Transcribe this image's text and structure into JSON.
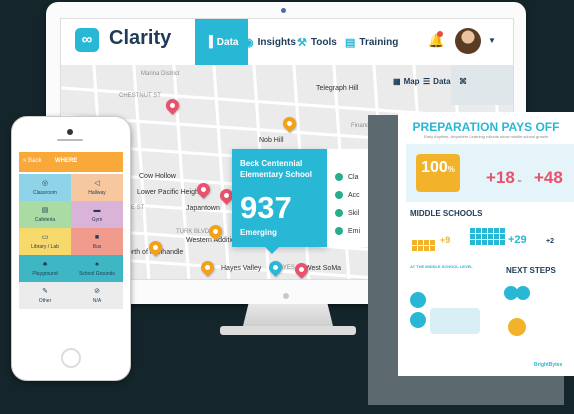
{
  "app": {
    "name": "Clarity",
    "nav": [
      {
        "label": "Data",
        "icon": "bar-chart-icon",
        "active": true
      },
      {
        "label": "Insights",
        "icon": "lightbulb-icon",
        "active": false
      },
      {
        "label": "Tools",
        "icon": "tools-icon",
        "active": false
      },
      {
        "label": "Training",
        "icon": "clipboard-icon",
        "active": false
      }
    ]
  },
  "map": {
    "view_toggle": {
      "map_label": "Map",
      "data_label": "Data"
    },
    "labels": {
      "marina": "Marina District",
      "telegraph": "Telegraph Hill",
      "nob_hill": "Nob Hill",
      "financial": "Financial District",
      "lower_pacific": "Lower Pacific Heights",
      "japantown": "Japantown",
      "western_addition": "Western Addition",
      "north_panhandle": "North of Panhandle",
      "hayes_valley": "Hayes Valley",
      "west_soma": "West SoMa",
      "cow_hollow": "Cow Hollow",
      "chestnut_st": "CHESTNUT ST",
      "pine_st": "PINE ST",
      "turk_blvd": "TURK BLVD",
      "hayes_st": "HAYES ST"
    }
  },
  "popup": {
    "school": "Beck Centennial Elementary School",
    "count": "937",
    "level": "Emerging"
  },
  "legend": [
    "Cla",
    "Acc",
    "Skil",
    "Emi"
  ],
  "phone": {
    "back": "< Back",
    "title": "WHERE",
    "locations": [
      {
        "label": "Classroom",
        "color": "#8fd3e8",
        "icon": "◎"
      },
      {
        "label": "Hallway",
        "color": "#f7c7a0",
        "icon": "◁"
      },
      {
        "label": "Cafeteria",
        "color": "#a9dba2",
        "icon": "▤"
      },
      {
        "label": "Gym",
        "color": "#d9b3d8",
        "icon": "▬"
      },
      {
        "label": "Library / Lab",
        "color": "#f7d86a",
        "icon": "▭"
      },
      {
        "label": "Bus",
        "color": "#f19b8c",
        "icon": "■"
      },
      {
        "label": "Playground",
        "color": "#3fb6c3",
        "icon": "♣"
      },
      {
        "label": "School Grounds",
        "color": "#3fb6c3",
        "icon": "♠"
      },
      {
        "label": "Other",
        "color": "#ececec",
        "icon": "✎"
      },
      {
        "label": "N/A",
        "color": "#ececec",
        "icon": "⊘"
      }
    ]
  },
  "poster": {
    "title": "PREPARATION PAYS OFF",
    "subtitle": "Early Anytime. Anywhere Learning rollouts show middle school growth",
    "stat_100": "100",
    "stat_100_unit": "%",
    "plus18": "+18",
    "plus48": "+48",
    "to_word": "to",
    "middle_schools": "MIDDLE SCHOOLS",
    "plus9": "+9",
    "plus29": "+29",
    "plus2": "+2",
    "at_middle": "AT THE MIDDLE SCHOOL LEVEL",
    "next_steps": "NEXT STEPS",
    "brand": "BrightBytes"
  }
}
